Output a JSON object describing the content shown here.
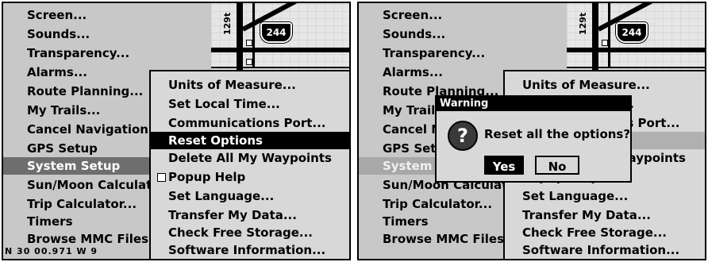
{
  "main_menu": {
    "items": [
      {
        "label": "Screen..."
      },
      {
        "label": "Sounds..."
      },
      {
        "label": "Transparency..."
      },
      {
        "label": "Alarms..."
      },
      {
        "label": "Route Planning..."
      },
      {
        "label": "My Trails..."
      },
      {
        "label": "Cancel Navigation"
      },
      {
        "label": "GPS Setup"
      },
      {
        "label": "System Setup"
      },
      {
        "label": "Sun/Moon Calculat"
      },
      {
        "label": "Trip Calculator..."
      },
      {
        "label": "Timers"
      },
      {
        "label": "Browse MMC Files"
      }
    ],
    "selected_label": "System Setup"
  },
  "submenu": {
    "items": [
      {
        "label": "Units of Measure..."
      },
      {
        "label": "Set Local Time..."
      },
      {
        "label": "Communications Port..."
      },
      {
        "label": "Reset Options"
      },
      {
        "label": "Delete All My Waypoints"
      },
      {
        "label": "Popup Help"
      },
      {
        "label": "Set Language..."
      },
      {
        "label": "Transfer My Data..."
      },
      {
        "label": "Check Free Storage..."
      },
      {
        "label": "Software Information..."
      }
    ],
    "selected_label": "Reset Options",
    "popup_help_checked": false
  },
  "map": {
    "highway_shield": "244",
    "road_label": "129t"
  },
  "status": {
    "partial_text": "N  30 00.971   W  9"
  },
  "dialog": {
    "title": "Warning",
    "icon": "question-icon",
    "message": "Reset all the options?",
    "yes_label": "Yes",
    "no_label": "No"
  }
}
